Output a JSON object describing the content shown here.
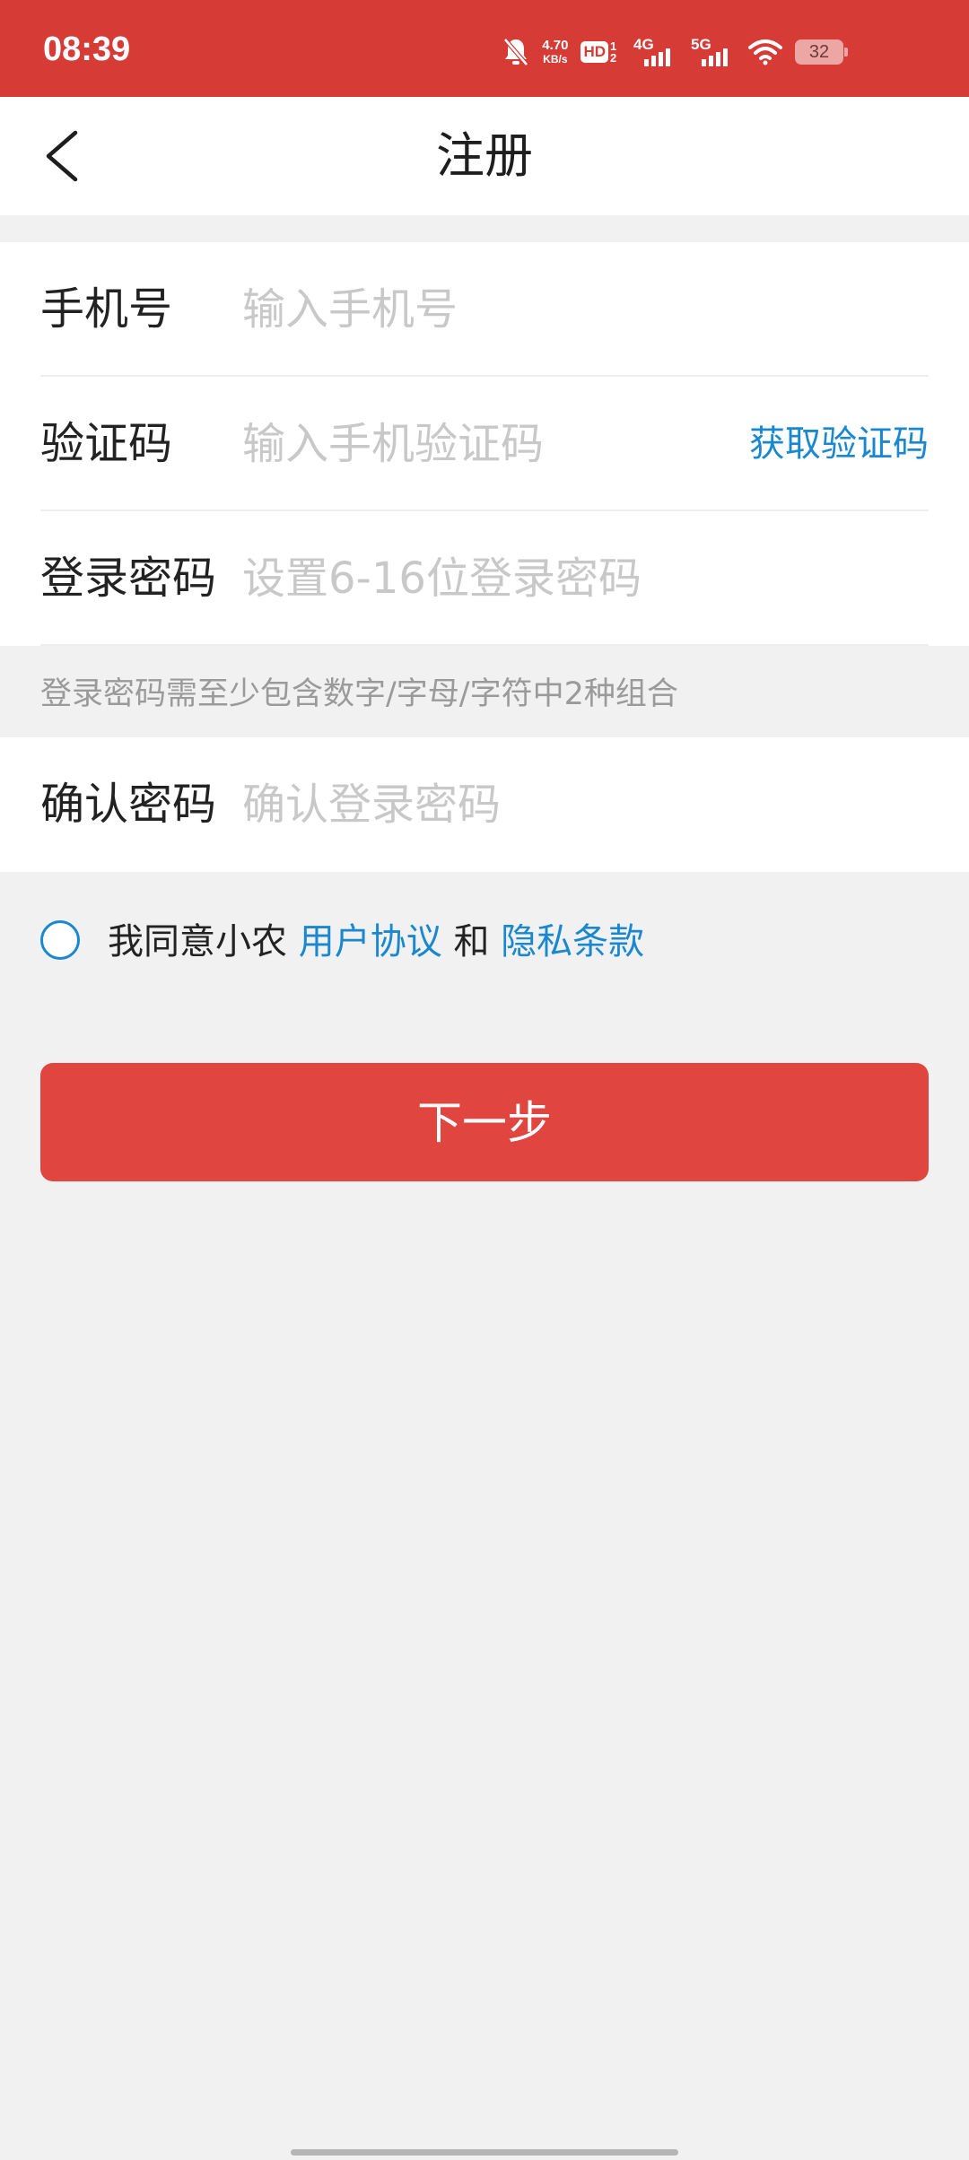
{
  "status_bar": {
    "time": "08:39",
    "net_speed_value": "4.70",
    "net_speed_unit": "KB/s",
    "hd_label": "HD",
    "hd_sub": "1 2",
    "signal_4g": "4G",
    "signal_5g": "5G",
    "battery": "32",
    "icons": [
      "mute-bell-icon",
      "wifi-icon",
      "battery-icon"
    ],
    "background": "#d63b36"
  },
  "nav": {
    "title": "注册",
    "back_icon": "chevron-left-icon"
  },
  "form": {
    "phone": {
      "label": "手机号",
      "placeholder": "输入手机号"
    },
    "code": {
      "label": "验证码",
      "placeholder": "输入手机验证码",
      "action": "获取验证码"
    },
    "password": {
      "label": "登录密码",
      "placeholder": "设置6-16位登录密码"
    },
    "password_hint": "登录密码需至少包含数字/字母/字符中2种组合",
    "confirm": {
      "label": "确认密码",
      "placeholder": "确认登录密码"
    }
  },
  "agreement": {
    "prefix": "我同意小农",
    "user_agreement": "用户协议",
    "conjunction": "和",
    "privacy": "隐私条款",
    "checked": false
  },
  "next_button": "下一步",
  "colors": {
    "accent": "#e04540",
    "link": "#1a88d0",
    "background": "#f1f1f1"
  }
}
